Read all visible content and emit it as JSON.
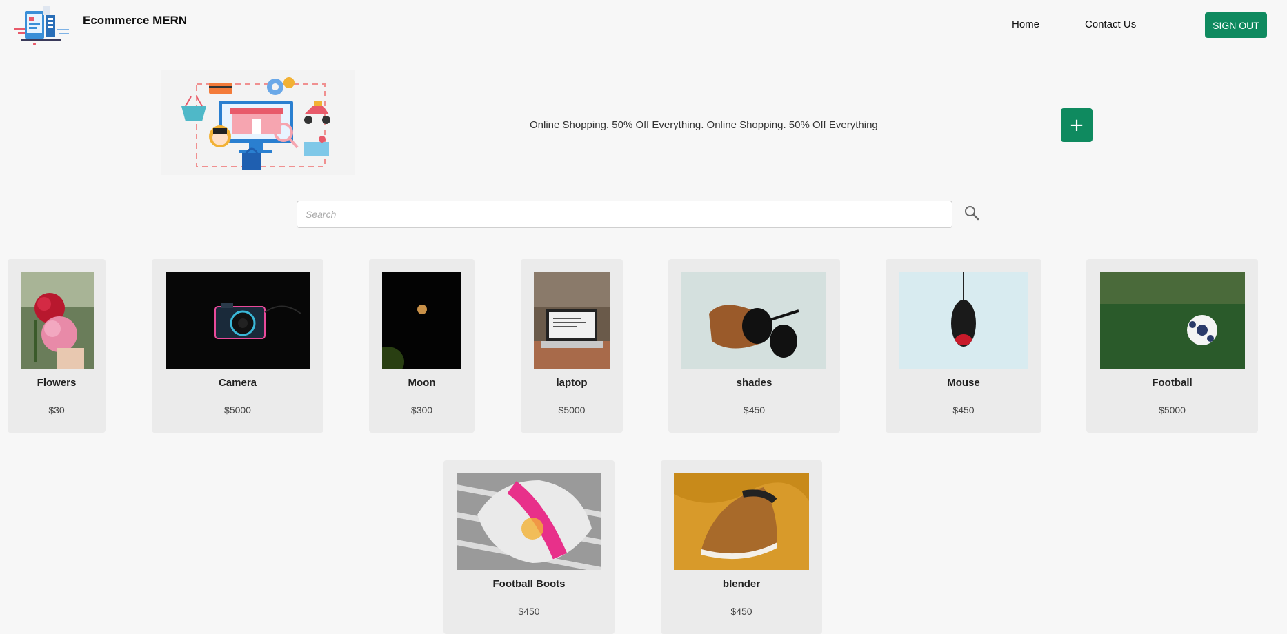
{
  "header": {
    "brand": "Ecommerce MERN",
    "nav": [
      "Home",
      "Contact Us"
    ],
    "signout_label": "SIGN OUT"
  },
  "banner": {
    "text": "Online Shopping. 50% Off Everything. Online Shopping. 50% Off Everything",
    "add_label": "+"
  },
  "search": {
    "placeholder": "Search"
  },
  "colors": {
    "accent": "#0f8a5f",
    "card_bg": "#ebebeb",
    "page_bg": "#f7f7f7"
  },
  "products": [
    {
      "name": "Flowers",
      "price": "$30"
    },
    {
      "name": "Camera",
      "price": "$5000"
    },
    {
      "name": "Moon",
      "price": "$300"
    },
    {
      "name": "laptop",
      "price": "$5000"
    },
    {
      "name": "shades",
      "price": "$450"
    },
    {
      "name": "Mouse",
      "price": "$450"
    },
    {
      "name": "Football",
      "price": "$5000"
    },
    {
      "name": "Football Boots",
      "price": "$450"
    },
    {
      "name": "blender",
      "price": "$450"
    }
  ]
}
